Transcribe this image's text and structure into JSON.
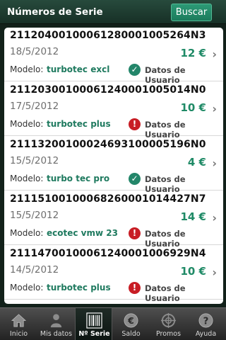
{
  "header": {
    "title": "Números de Serie",
    "search_label": "Buscar"
  },
  "list": {
    "items": [
      {
        "serial": "21120400100061280001005264N3",
        "date": "18/5/2012",
        "price": "12 €",
        "model_label": "Modelo:",
        "model": "turbotec excl",
        "status_icon": "check-circle-icon",
        "status_text": "Datos de Usuario"
      },
      {
        "serial": "21120300100061240001005014N0",
        "date": "17/5/2012",
        "price": "10 €",
        "model_label": "Modelo:",
        "model": "turbotec plus",
        "status_icon": "warning-circle-icon",
        "status_text": "Datos de Usuario"
      },
      {
        "serial": "21113200100024693100005196N0",
        "date": "15/5/2012",
        "price": "4 €",
        "model_label": "Modelo:",
        "model": "turbo tec pro",
        "status_icon": "check-circle-icon",
        "status_text": "Datos de Usuario"
      },
      {
        "serial": "21115100100068260001014427N7",
        "date": "15/5/2012",
        "price": "14 €",
        "model_label": "Modelo:",
        "model": "ecotec vmw 23",
        "status_icon": "warning-circle-icon",
        "status_text": "Datos de Usuario"
      },
      {
        "serial": "21114700100061240001006929N4",
        "date": "14/5/2012",
        "price": "10 €",
        "model_label": "Modelo:",
        "model": "turbotec plus",
        "status_icon": "warning-circle-icon",
        "status_text": "Datos de Usuario"
      }
    ]
  },
  "tabs": [
    {
      "label": "Inicio",
      "icon": "home-icon",
      "active": false
    },
    {
      "label": "Mis datos",
      "icon": "user-icon",
      "active": false
    },
    {
      "label": "Nº Serie",
      "icon": "barcode-icon",
      "active": true
    },
    {
      "label": "Saldo",
      "icon": "euro-icon",
      "active": false
    },
    {
      "label": "Promos",
      "icon": "target-icon",
      "active": false
    },
    {
      "label": "Ayuda",
      "icon": "help-icon",
      "active": false
    }
  ],
  "colors": {
    "accent": "#1f8a66",
    "ok": "#23866a",
    "warn": "#c81d25"
  }
}
